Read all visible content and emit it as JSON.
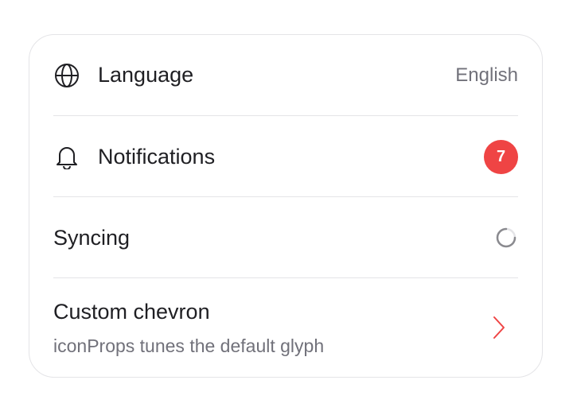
{
  "settings": {
    "rows": [
      {
        "label": "Language",
        "icon": "globe-icon",
        "value": "English"
      },
      {
        "label": "Notifications",
        "icon": "bell-icon",
        "badge": "7"
      },
      {
        "label": "Syncing",
        "icon": "spinner-icon"
      },
      {
        "label": "Custom chevron",
        "description": "iconProps tunes the default glyph",
        "icon": "chevron-right-icon"
      }
    ]
  },
  "colors": {
    "badge": "#ef4444",
    "chevron": "#ef4444",
    "border": "#e4e4e7",
    "text": "#1f1f23",
    "muted": "#71717a"
  }
}
